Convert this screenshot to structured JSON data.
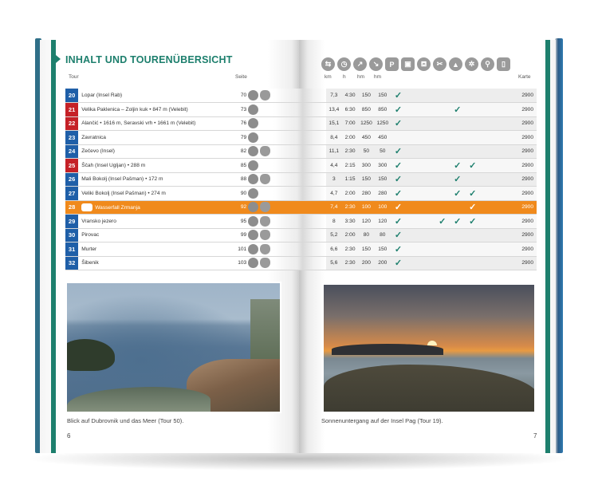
{
  "heading": "INHALT UND TOURENÜBERSICHT",
  "column_headers": {
    "tour": "Tour",
    "seite": "Seite",
    "km": "km",
    "h": "h",
    "hm1": "hm",
    "hm2": "hm",
    "karte": "Karte"
  },
  "icons": [
    "signpost-icon",
    "clock-icon",
    "ascent-icon",
    "descent-icon",
    "parking-icon",
    "bus-icon",
    "restaurant-icon",
    "cutlery-icon",
    "summit-icon",
    "snowflake-icon",
    "bike-icon",
    "phone-icon"
  ],
  "icon_glyphs": [
    "⇆",
    "◷",
    "↗",
    "↘",
    "P",
    "▣",
    "⛾",
    "✂",
    "▲",
    "✲",
    "⚲",
    "▯"
  ],
  "rows": [
    {
      "num": "20",
      "color": "#1f5fa8",
      "name": "Lopar (Insel Rab)",
      "seite": "70",
      "badges": 2,
      "km": "7,3",
      "h": "4:30",
      "hm1": "150",
      "hm2": "150",
      "checks": [
        true,
        false,
        false,
        false,
        false,
        false,
        false,
        false
      ],
      "karte": "2900"
    },
    {
      "num": "21",
      "color": "#c52127",
      "name": "Velika Paklenica – Zoljin kuk • 847 m (Velebit)",
      "seite": "73",
      "badges": 1,
      "km": "13,4",
      "h": "6:30",
      "hm1": "850",
      "hm2": "850",
      "checks": [
        true,
        false,
        false,
        false,
        true,
        false,
        false,
        false
      ],
      "karte": "2900"
    },
    {
      "num": "22",
      "color": "#c52127",
      "name": "Alančić • 1616 m, Seravski vrh • 1661 m (Velebit)",
      "seite": "76",
      "badges": 1,
      "km": "15,1",
      "h": "7:00",
      "hm1": "1250",
      "hm2": "1250",
      "checks": [
        true,
        false,
        false,
        false,
        false,
        false,
        false,
        false
      ],
      "karte": "2900"
    },
    {
      "num": "23",
      "color": "#1f5fa8",
      "name": "Zavratnica",
      "seite": "79",
      "badges": 1,
      "km": "8,4",
      "h": "2:00",
      "hm1": "450",
      "hm2": "450",
      "checks": [
        false,
        false,
        false,
        false,
        false,
        false,
        false,
        false
      ],
      "karte": "2900"
    },
    {
      "num": "24",
      "color": "#1f5fa8",
      "name": "Zečevo (Insel)",
      "seite": "82",
      "badges": 2,
      "km": "11,1",
      "h": "2:30",
      "hm1": "50",
      "hm2": "50",
      "checks": [
        true,
        false,
        false,
        false,
        false,
        false,
        false,
        false
      ],
      "karte": "2900"
    },
    {
      "num": "25",
      "color": "#c52127",
      "name": "Ščah (Insel Ugljan) • 288 m",
      "seite": "85",
      "badges": 1,
      "km": "4,4",
      "h": "2:15",
      "hm1": "300",
      "hm2": "300",
      "checks": [
        true,
        false,
        false,
        false,
        true,
        true,
        false,
        false
      ],
      "karte": "2900"
    },
    {
      "num": "26",
      "color": "#1f5fa8",
      "name": "Mali Bokolj (Insel Pašman) • 172 m",
      "seite": "88",
      "badges": 2,
      "km": "3",
      "h": "1:15",
      "hm1": "150",
      "hm2": "150",
      "checks": [
        true,
        false,
        false,
        false,
        true,
        false,
        false,
        false
      ],
      "karte": "2900"
    },
    {
      "num": "27",
      "color": "#1f5fa8",
      "name": "Veliki Bokolj (Insel Pašman) • 274 m",
      "seite": "90",
      "badges": 1,
      "km": "4,7",
      "h": "2:00",
      "hm1": "280",
      "hm2": "280",
      "checks": [
        true,
        false,
        false,
        false,
        true,
        true,
        false,
        false
      ],
      "karte": "2900"
    },
    {
      "num": "28",
      "color": "#f08a1c",
      "name": "Wasserfall Zrmanja",
      "seite": "92",
      "badges": 2,
      "km": "7,4",
      "h": "2:30",
      "hm1": "100",
      "hm2": "100",
      "checks": [
        true,
        false,
        false,
        false,
        false,
        true,
        false,
        false
      ],
      "karte": "2900",
      "highlight": true
    },
    {
      "num": "29",
      "color": "#1f5fa8",
      "name": "Vransko jezero",
      "seite": "95",
      "badges": 2,
      "km": "8",
      "h": "3:30",
      "hm1": "120",
      "hm2": "120",
      "checks": [
        true,
        false,
        false,
        true,
        true,
        true,
        false,
        false
      ],
      "karte": "2900"
    },
    {
      "num": "30",
      "color": "#1f5fa8",
      "name": "Pirovac",
      "seite": "99",
      "badges": 2,
      "km": "5,2",
      "h": "2:00",
      "hm1": "80",
      "hm2": "80",
      "checks": [
        true,
        false,
        false,
        false,
        false,
        false,
        false,
        false
      ],
      "karte": "2900"
    },
    {
      "num": "31",
      "color": "#1f5fa8",
      "name": "Murter",
      "seite": "101",
      "badges": 2,
      "km": "6,6",
      "h": "2:30",
      "hm1": "150",
      "hm2": "150",
      "checks": [
        true,
        false,
        false,
        false,
        false,
        false,
        false,
        false
      ],
      "karte": "2900"
    },
    {
      "num": "32",
      "color": "#1f5fa8",
      "name": "Šibenik",
      "seite": "103",
      "badges": 2,
      "km": "5,6",
      "h": "2:30",
      "hm1": "200",
      "hm2": "200",
      "checks": [
        true,
        false,
        false,
        false,
        false,
        false,
        false,
        false
      ],
      "karte": "2900"
    }
  ],
  "captions": {
    "left": "Blick auf Dubrovnik und das Meer (Tour 50).",
    "right": "Sonnenuntergang auf der Insel Pag (Tour 19)."
  },
  "page_numbers": {
    "left": "6",
    "right": "7"
  },
  "colors": {
    "teal": "#1d7f6d",
    "orange": "#f08a1c",
    "blue": "#1f5fa8",
    "red": "#c52127"
  }
}
